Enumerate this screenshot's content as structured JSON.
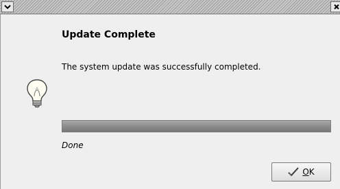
{
  "dialog": {
    "heading": "Update Complete",
    "message": "The system update was successfully completed.",
    "progress_fraction": 1.0,
    "status_text": "Done",
    "ok_button": {
      "mnemonic": "O",
      "rest": "K",
      "icon": "checkmark-icon"
    },
    "bulb_icon": "lightbulb-icon"
  },
  "titlebar": {
    "menu_icon": "chevron-down-icon",
    "close_icon": "close-icon"
  },
  "colors": {
    "window_bg": "#efefef",
    "progress_fill": "#8c8c8c",
    "titlebar_bg": "#b8b8b8"
  }
}
